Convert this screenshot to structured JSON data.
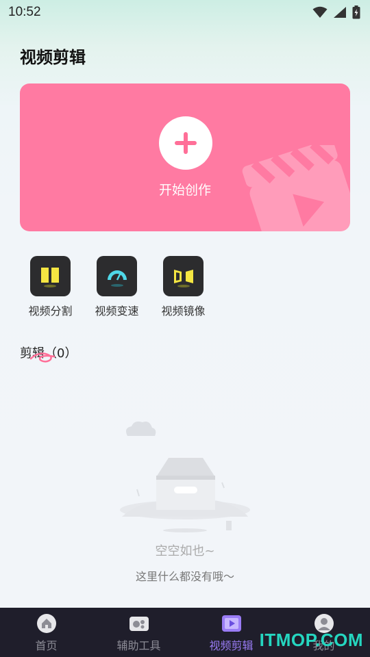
{
  "status_bar": {
    "time": "10:52"
  },
  "page": {
    "title": "视频剪辑"
  },
  "hero": {
    "label": "开始创作"
  },
  "tools": [
    {
      "label": "视频分割",
      "icon": "split-icon",
      "accent": "#f5e642"
    },
    {
      "label": "视频变速",
      "icon": "speedometer-icon",
      "accent": "#4fd8e8"
    },
    {
      "label": "视频镜像",
      "icon": "mirror-icon",
      "accent": "#f5e642"
    }
  ],
  "section": {
    "title": "剪辑",
    "count": "（0）"
  },
  "empty_state": {
    "main": "空空如也~",
    "sub": "这里什么都没有哦～"
  },
  "bottom_nav": {
    "items": [
      {
        "label": "首页",
        "icon": "home-icon"
      },
      {
        "label": "辅助工具",
        "icon": "tools-icon"
      },
      {
        "label": "视频剪辑",
        "icon": "video-edit-icon",
        "active": true
      },
      {
        "label": "我的",
        "icon": "profile-icon"
      }
    ]
  },
  "watermark": "ITMOP.COM",
  "colors": {
    "hero": "#ff7aa2",
    "nav_bg": "#1f1e2b",
    "nav_active": "#9a7cf5"
  }
}
